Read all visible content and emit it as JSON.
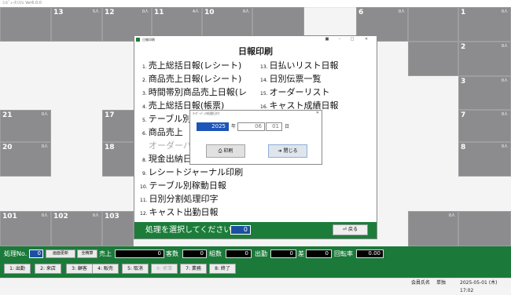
{
  "app": {
    "title": "ｺﾝﾋﾟｭｰﾀｼｽﾃﾑ Ver6.0.0"
  },
  "tables": [
    {
      "num": "13",
      "count": "5人"
    },
    {
      "num": "12",
      "count": "0人"
    },
    {
      "num": "11",
      "count": "4人"
    },
    {
      "num": "10",
      "count": "0人"
    },
    {
      "num": "6",
      "count": "0人"
    },
    {
      "num": "1",
      "count": "0人"
    },
    {
      "num": "2",
      "count": "0人"
    },
    {
      "num": "3",
      "count": "0人"
    },
    {
      "num": "21",
      "count": "0人"
    },
    {
      "num": "17",
      "count": ""
    },
    {
      "num": "7",
      "count": "0人"
    },
    {
      "num": "20",
      "count": "0人"
    },
    {
      "num": "18",
      "count": ""
    },
    {
      "num": "8",
      "count": "0人"
    },
    {
      "num": "101",
      "count": "0人"
    },
    {
      "num": "102",
      "count": "0人"
    },
    {
      "num": "103",
      "count": ""
    },
    {
      "num": "",
      "count": "0人"
    }
  ],
  "report_window": {
    "window_title": "日報印刷",
    "heading": "日報印刷",
    "left_items": [
      {
        "n": "1.",
        "label": "売上総括日報(レシート)"
      },
      {
        "n": "2.",
        "label": "商品売上日報(レシート)"
      },
      {
        "n": "3.",
        "label": "時間帯別商品売上日報(レ"
      },
      {
        "n": "4.",
        "label": "売上総括日報(帳票)"
      },
      {
        "n": "5.",
        "label": "テーブル別"
      },
      {
        "n": "6.",
        "label": "商品売上"
      },
      {
        "n": "",
        "label": "オーダーバ"
      },
      {
        "n": "8.",
        "label": "現金出納日"
      },
      {
        "n": "9.",
        "label": "レシートジャーナル印刷"
      },
      {
        "n": "10.",
        "label": "テーブル別稼動日報"
      },
      {
        "n": "11.",
        "label": "日別分割処理印字"
      },
      {
        "n": "12.",
        "label": "キャスト出勤日報"
      }
    ],
    "right_items": [
      {
        "n": "13.",
        "label": "日払いリスト日報"
      },
      {
        "n": "14.",
        "label": "日別伝票一覧"
      },
      {
        "n": "15.",
        "label": "オーダーリスト"
      },
      {
        "n": "16.",
        "label": "キャスト成績日報"
      }
    ],
    "footer_prompt": "処理を選択してください。",
    "footer_value": "0",
    "back_label": "戻る"
  },
  "date_dialog": {
    "title": "ｵｰﾀﾞｰﾊﾞｯｸ処理日付",
    "year": "2025",
    "month": "06",
    "day": "01",
    "year_unit": "年",
    "month_unit": "月",
    "day_unit": "日",
    "print_label": "印刷",
    "close_label": "閉じる"
  },
  "bottom_bar": {
    "proc_label": "処理No.",
    "proc_value": "0",
    "screen_update": "画面更新",
    "all_settle": "全精算",
    "sales_label": "売上",
    "sales_value": "0",
    "customers_label": "客数",
    "customers_value": "0",
    "groups_label": "組数",
    "groups_value": "0",
    "attend_label": "出勤",
    "attend_value": "0",
    "diff_label": "差",
    "diff_value": "0",
    "turnover_label": "回転率",
    "turnover_value": "0.00",
    "function_buttons": [
      "1: 出勤",
      "2: 来店",
      "3: 顧客",
      "4: 販売",
      "5: 取消",
      "6: 帳簿",
      "7: 業務",
      "8: 終了"
    ]
  },
  "status_bar": {
    "company": "会員氏名",
    "user": "単独",
    "datetime": "2025-05-01 (木) 17:02"
  }
}
